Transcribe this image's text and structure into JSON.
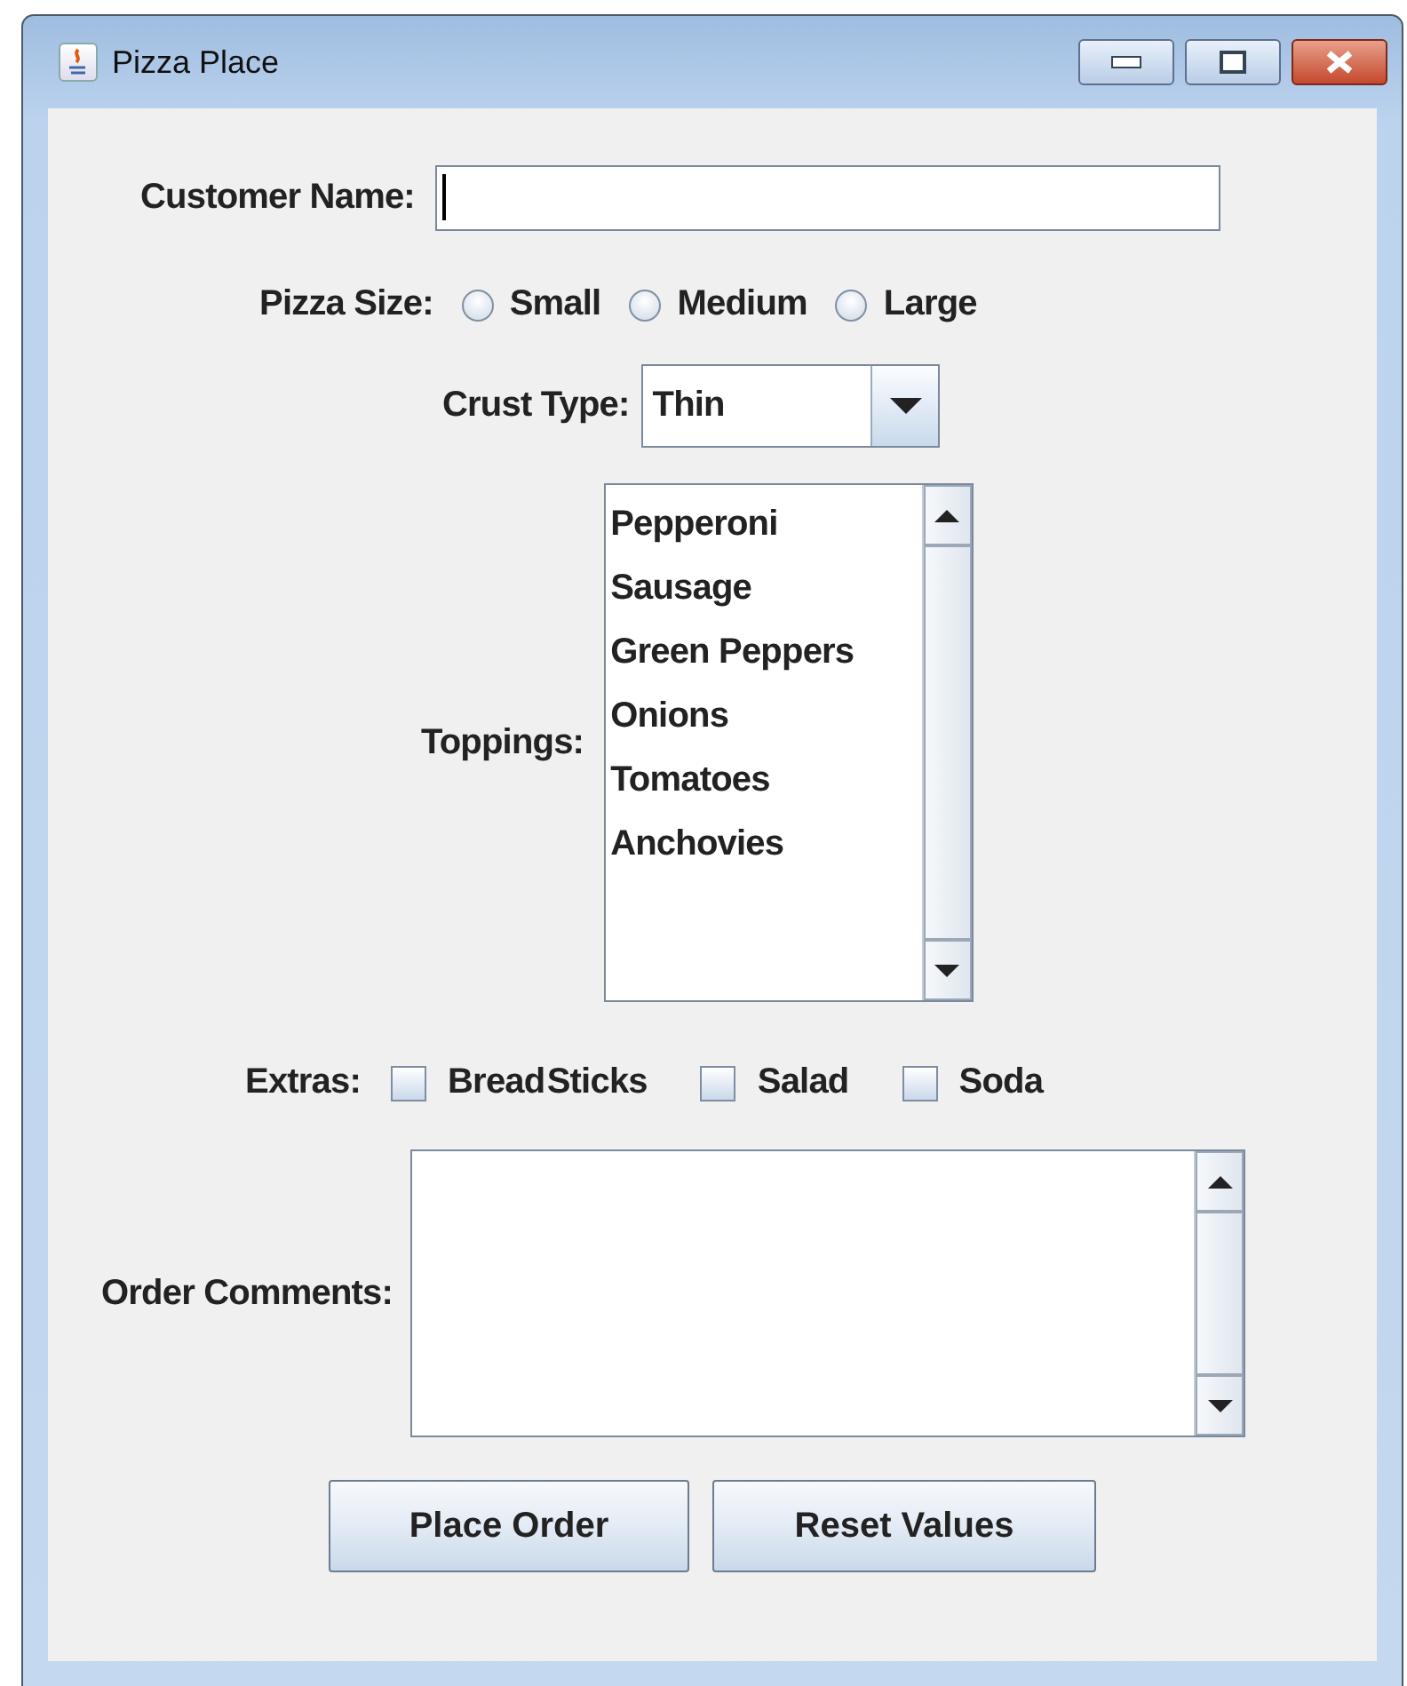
{
  "window": {
    "title": "Pizza Place"
  },
  "customer_name": {
    "label": "Customer Name:"
  },
  "pizza_size": {
    "label": "Pizza Size:",
    "options": [
      {
        "label": "Small",
        "selected": false
      },
      {
        "label": "Medium",
        "selected": false
      },
      {
        "label": "Large",
        "selected": false
      }
    ]
  },
  "crust_type": {
    "label": "Crust Type:",
    "value": "Thin"
  },
  "toppings": {
    "label": "Toppings:",
    "items": [
      {
        "label": "Pepperoni",
        "selected": false
      },
      {
        "label": "Sausage",
        "selected": false
      },
      {
        "label": "Green Peppers",
        "selected": false
      },
      {
        "label": "Onions",
        "selected": false
      },
      {
        "label": "Tomatoes",
        "selected": false
      },
      {
        "label": "Anchovies",
        "selected": false
      }
    ]
  },
  "extras": {
    "label": "Extras:",
    "options": [
      {
        "label": "Bread Sticks",
        "checked": false
      },
      {
        "label": "Salad",
        "checked": false
      },
      {
        "label": "Soda",
        "checked": false
      }
    ]
  },
  "order_comments": {
    "label": "Order Comments:"
  },
  "buttons": [
    {
      "label": "Place Order"
    },
    {
      "label": "Reset Values"
    }
  ]
}
